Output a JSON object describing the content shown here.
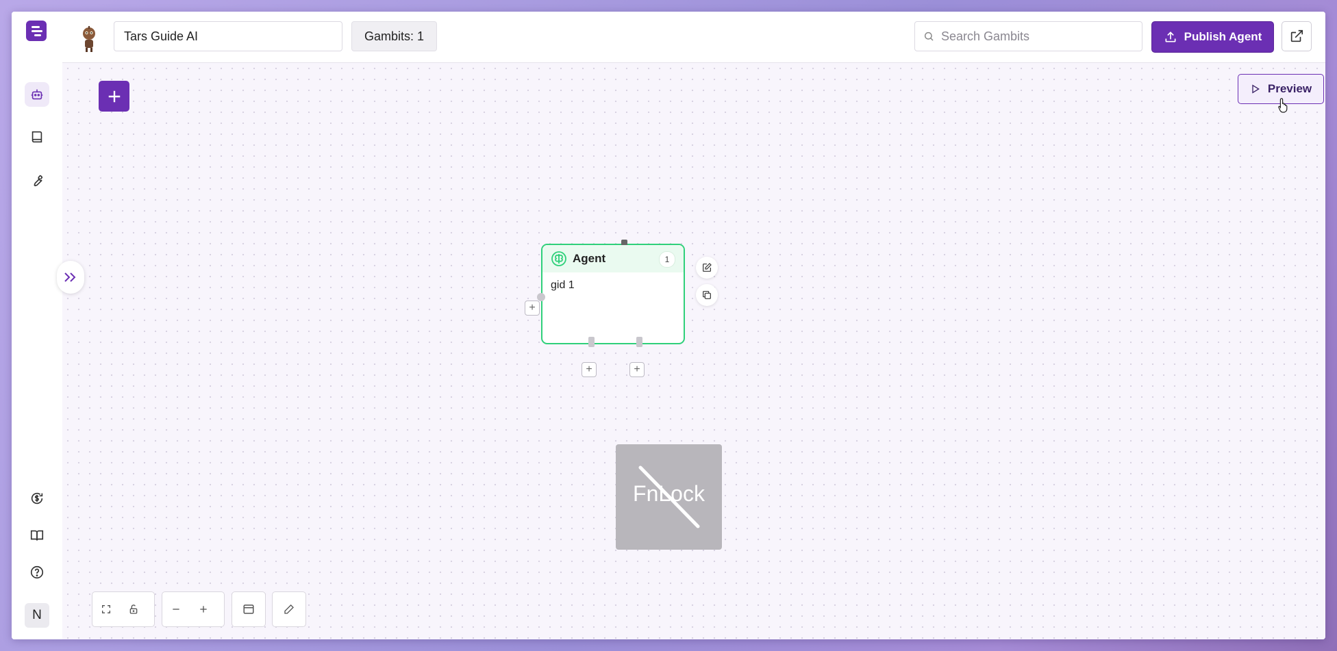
{
  "header": {
    "agent_name": "Tars Guide AI",
    "gambits_badge": "Gambits: 1",
    "search_placeholder": "Search Gambits",
    "publish_label": "Publish Agent"
  },
  "sidebar": {
    "top_items": [
      {
        "icon": "robot-icon",
        "active": true
      },
      {
        "icon": "book-icon",
        "active": false
      },
      {
        "icon": "wrench-icon",
        "active": false
      }
    ],
    "bottom_items": [
      {
        "icon": "billing-icon"
      },
      {
        "icon": "docs-icon"
      },
      {
        "icon": "help-icon"
      }
    ],
    "user_initial": "N"
  },
  "canvas": {
    "preview_label": "Preview",
    "node": {
      "title": "Agent",
      "count": "1",
      "body": "gid 1",
      "icon": "brain-icon"
    },
    "overlay_text": "FnLock"
  },
  "colors": {
    "brand": "#6b2fb3",
    "node_border": "#2fd07a",
    "node_header": "#eafaf0"
  }
}
